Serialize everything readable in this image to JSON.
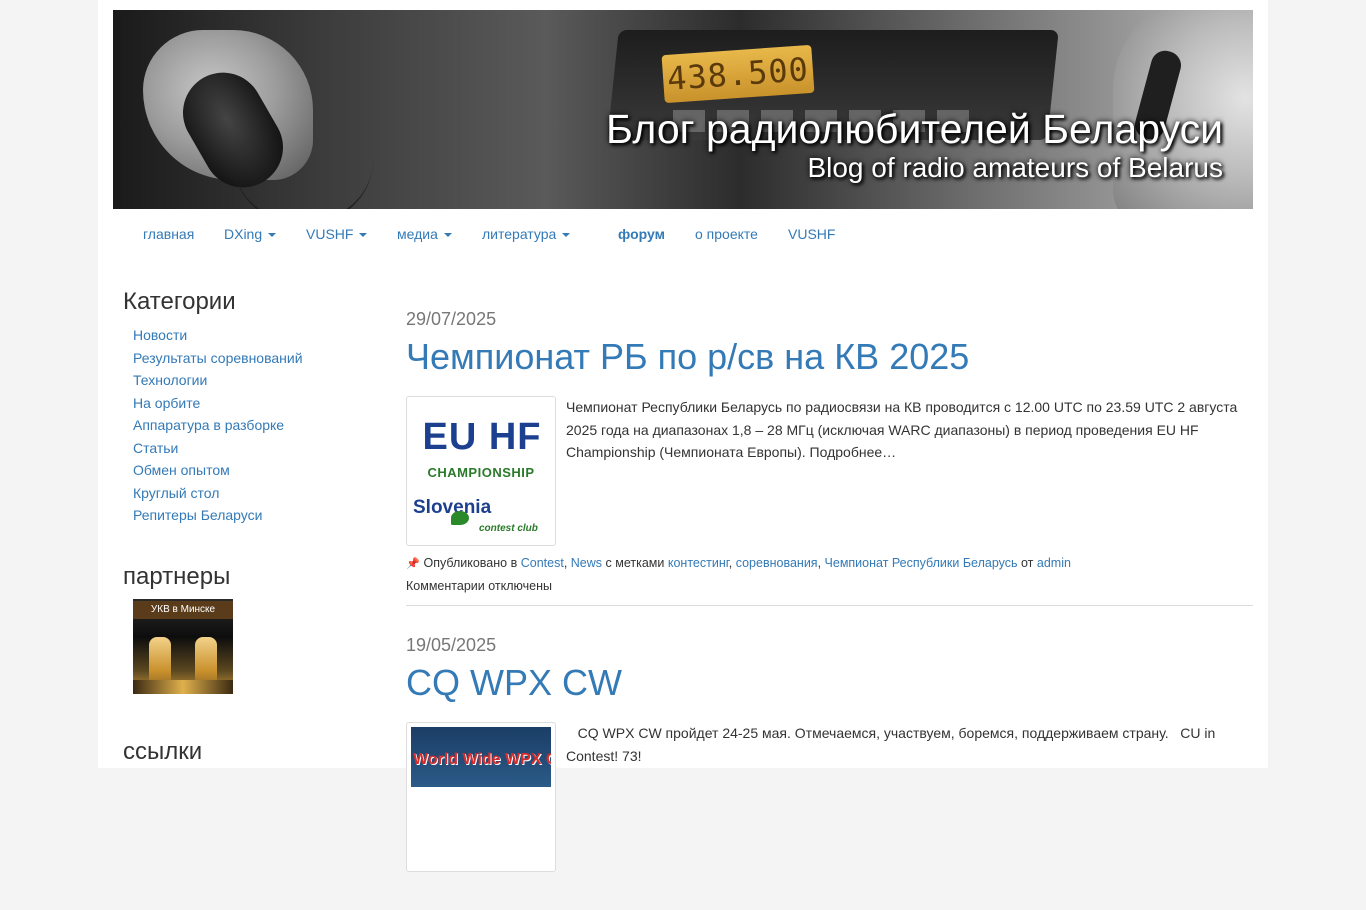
{
  "header": {
    "title": "Блог радиолюбителей Беларуси",
    "subtitle": "Blog of radio amateurs of Belarus",
    "frequency_display": "438.500"
  },
  "nav": {
    "items": [
      {
        "label": "главная",
        "dropdown": false
      },
      {
        "label": "DXing",
        "dropdown": true
      },
      {
        "label": "VUSHF",
        "dropdown": true
      },
      {
        "label": "медиа",
        "dropdown": true
      },
      {
        "label": "литература",
        "dropdown": true
      },
      {
        "label": "форум",
        "dropdown": false,
        "bold": true
      },
      {
        "label": "о проекте",
        "dropdown": false
      },
      {
        "label": "VUSHF",
        "dropdown": false
      }
    ]
  },
  "sidebar": {
    "categories_title": "Категории",
    "categories": [
      "Новости",
      "Результаты соревнований",
      "Технологии",
      "На орбите",
      "Аппаратура в разборке",
      "Статьи",
      "Обмен опытом",
      "Круглый стол",
      "Репитеры Беларуси"
    ],
    "partners_title": "партнеры",
    "partner_banner_label": "УКВ в Минске",
    "links_title": "ссылки"
  },
  "posts": [
    {
      "date": "29/07/2025",
      "title": "Чемпионат РБ по р/св на КВ 2025",
      "thumb": {
        "line1": "EU HF",
        "line2": "CHAMPIONSHIP",
        "line3": "Slovenia",
        "line4": "contest club"
      },
      "excerpt": "Чемпионат Республики Беларусь по радиосвязи на КВ проводится с 12.00 UTC по 23.59 UTC 2 августа 2025 года на диапазонах 1,8 – 28 МГц (исключая WARC диапазоны) в период проведения EU HF Championship (Чемпионата Европы). Подробнее…",
      "meta": {
        "published_in": "Опубликовано в",
        "cat1": "Contest",
        "cat2": "News",
        "tags_label": "с метками",
        "tag1": "контестинг",
        "tag2": "соревнования",
        "tag3": "Чемпионат Республики Беларусь",
        "by": "от",
        "author": "admin",
        "comments": "Комментарии отключены"
      }
    },
    {
      "date": "19/05/2025",
      "title": "CQ WPX CW",
      "thumb_text": "World Wide WPX Con",
      "excerpt": "   CQ WPX CW пройдет 24-25 мая. Отмечаемся, участвуем, боремся, поддерживаем страну.   CU in Contest! 73!"
    }
  ]
}
